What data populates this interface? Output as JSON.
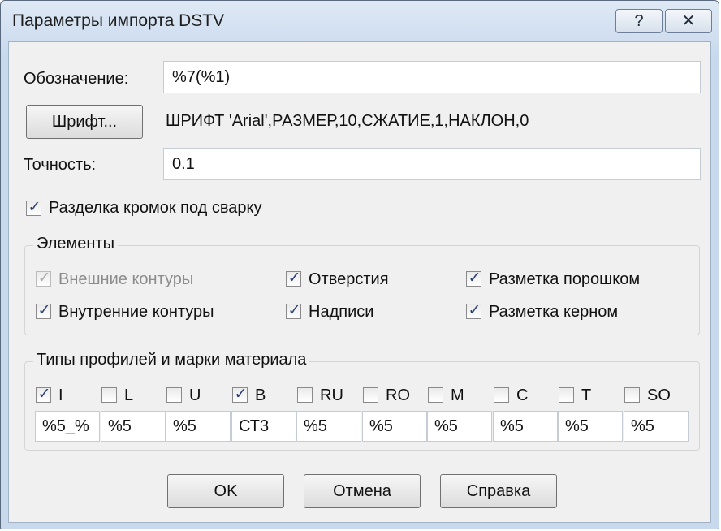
{
  "window": {
    "title": "Параметры импорта DSTV",
    "help_btn": "?",
    "close_btn": "✕"
  },
  "designation": {
    "label": "Обозначение:",
    "value": "%7(%1)"
  },
  "font": {
    "button": "Шрифт...",
    "description": "ШРИФТ 'Arial',РАЗМЕР,10,СЖАТИЕ,1,НАКЛОН,0"
  },
  "precision": {
    "label": "Точность:",
    "value": "0.1"
  },
  "edge_prep": {
    "label": "Разделка кромок под сварку",
    "checked": true
  },
  "elements": {
    "title": "Элементы",
    "items": [
      {
        "label": "Внешние контуры",
        "checked": true,
        "disabled": true
      },
      {
        "label": "Отверстия",
        "checked": true
      },
      {
        "label": "Разметка порошком",
        "checked": true
      },
      {
        "label": "Внутренние контуры",
        "checked": true
      },
      {
        "label": "Надписи",
        "checked": true
      },
      {
        "label": "Разметка керном",
        "checked": true
      }
    ]
  },
  "profiles": {
    "title": "Типы профилей и марки материала",
    "items": [
      {
        "label": "I",
        "checked": true,
        "value": "%5_%"
      },
      {
        "label": "L",
        "checked": false,
        "value": "%5"
      },
      {
        "label": "U",
        "checked": false,
        "value": "%5"
      },
      {
        "label": "B",
        "checked": true,
        "value": "СТ3"
      },
      {
        "label": "RU",
        "checked": false,
        "value": "%5"
      },
      {
        "label": "RO",
        "checked": false,
        "value": "%5"
      },
      {
        "label": "M",
        "checked": false,
        "value": "%5"
      },
      {
        "label": "C",
        "checked": false,
        "value": "%5"
      },
      {
        "label": "T",
        "checked": false,
        "value": "%5"
      },
      {
        "label": "SO",
        "checked": false,
        "value": "%5"
      }
    ]
  },
  "buttons": {
    "ok": "OK",
    "cancel": "Отмена",
    "help": "Справка"
  }
}
